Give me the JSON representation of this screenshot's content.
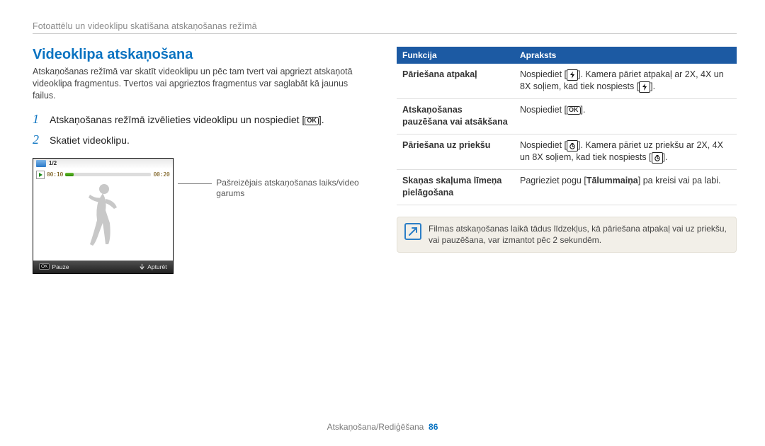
{
  "breadcrumb": "Fotoattēlu un videoklipu skatīšana atskaņošanas režīmā",
  "left": {
    "title": "Videoklipa atskaņošana",
    "intro": "Atskaņošanas režīmā var skatīt videoklipu un pēc tam tvert vai apgriezt atskaņotā videoklipa fragmentus. Tvertos vai apgrieztos fragmentus var saglabāt kā jaunus failus.",
    "steps": [
      {
        "num": "1",
        "text_pre": "Atskaņošanas režīmā izvēlieties videoklipu un nospiediet [",
        "text_post": "]."
      },
      {
        "num": "2",
        "text_full": "Skatiet videoklipu."
      }
    ],
    "figure": {
      "counter": "1/2",
      "time_current": "00:10",
      "time_total": "00:20",
      "bottom_left_key": "OK",
      "bottom_left_label": "Pauze",
      "bottom_right_label": "Apturēt"
    },
    "annotation": "Pašreizējais atskaņošanas laiks/video garums"
  },
  "right": {
    "headers": {
      "col1": "Funkcija",
      "col2": "Apraksts"
    },
    "rows": [
      {
        "func": "Pāriešana atpakaļ",
        "desc_pre": "Nospiediet [",
        "desc_mid": "]. Kamera pāriet atpakaļ ar 2X, 4X un 8X soļiem, kad tiek nospiests [",
        "desc_post": "].",
        "icon": "flash"
      },
      {
        "func": "Atskaņošanas pauzēšana vai atsākšana",
        "desc_pre": "Nospiediet [",
        "desc_post": "].",
        "icon": "ok"
      },
      {
        "func": "Pāriešana uz priekšu",
        "desc_pre": "Nospiediet [",
        "desc_mid": "]. Kamera pāriet uz priekšu ar 2X, 4X un 8X soļiem, kad tiek nospiests [",
        "desc_post": "].",
        "icon": "timer"
      },
      {
        "func": "Skaņas skaļuma līmeņa pielāgošana",
        "desc_pre": "Pagrieziet pogu [",
        "desc_bold": "Tālummaiņa",
        "desc_post": "] pa kreisi vai pa labi.",
        "icon": "none"
      }
    ],
    "note": "Filmas atskaņošanas laikā tādus līdzekļus, kā pāriešana atpakaļ vai uz priekšu, vai pauzēšana, var izmantot pēc 2 sekundēm."
  },
  "footer": {
    "section": "Atskaņošana/Rediģēšana",
    "page": "86"
  }
}
